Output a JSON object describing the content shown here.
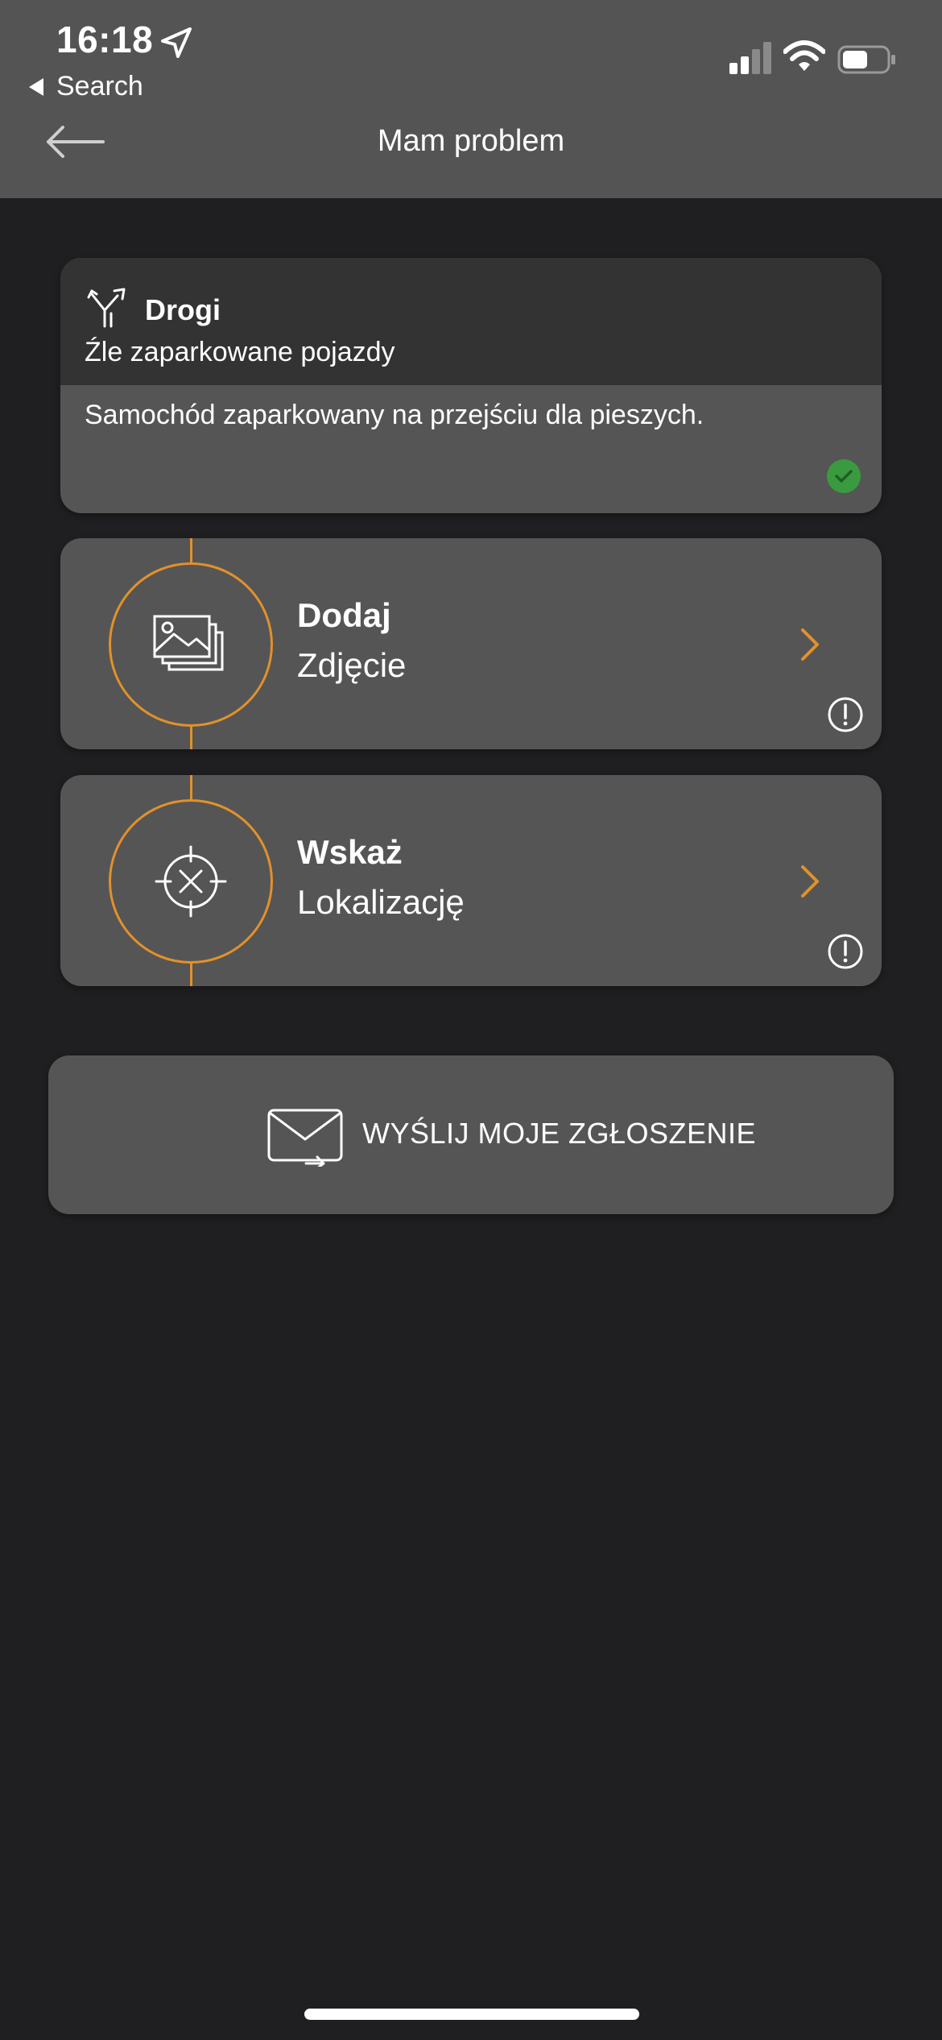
{
  "status_bar": {
    "time": "16:18",
    "back_app": "Search"
  },
  "nav": {
    "title": "Mam problem"
  },
  "category": {
    "name": "Drogi",
    "subcategory": "Źle zaparkowane pojazdy",
    "description": "Samochód zaparkowany na przejściu dla pieszych.",
    "status_color": "#3a9a3f"
  },
  "steps": [
    {
      "title": "Dodaj",
      "subtitle": "Zdjęcie",
      "icon": "photos-icon"
    },
    {
      "title": "Wskaż",
      "subtitle": "Lokalizację",
      "icon": "crosshair-icon"
    }
  ],
  "send": {
    "label": "WYŚLIJ MOJE ZGŁOSZENIE",
    "icon": "mail-send-icon"
  },
  "colors": {
    "accent": "#e2912b",
    "header_bg": "#545454",
    "page_bg": "#1f1f21",
    "card_bg": "#555555"
  }
}
